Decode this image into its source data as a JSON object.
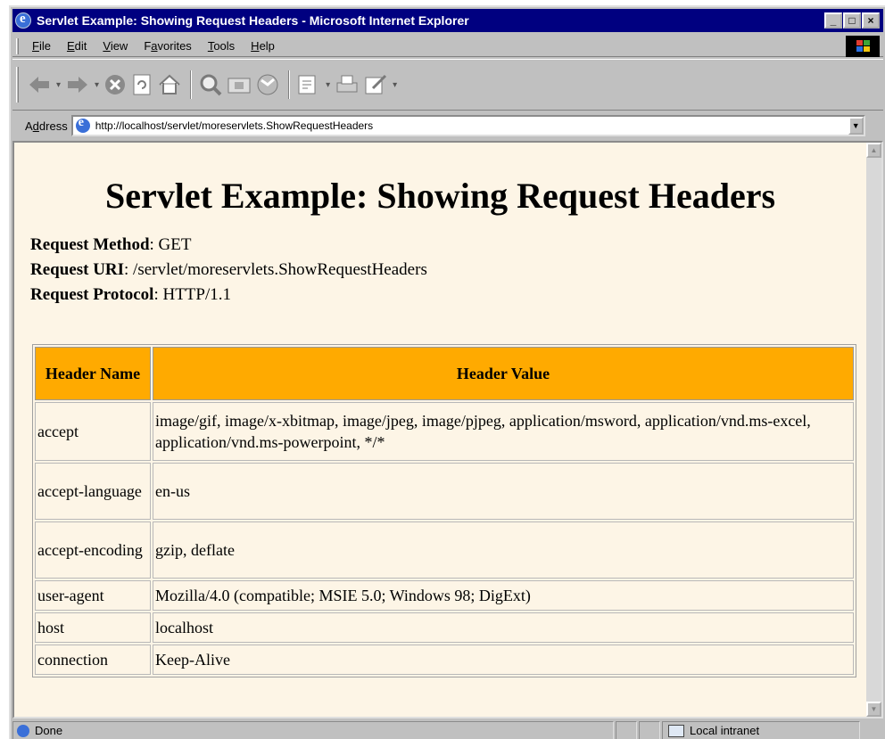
{
  "window": {
    "title": "Servlet Example: Showing Request Headers - Microsoft Internet Explorer",
    "controls": {
      "minimize": "_",
      "restore": "□",
      "close": "×"
    }
  },
  "menu": {
    "items": [
      {
        "key": "F",
        "rest": "ile"
      },
      {
        "key": "E",
        "rest": "dit"
      },
      {
        "key": "V",
        "rest": "iew"
      },
      {
        "pre": "F",
        "key": "a",
        "rest": "vorites"
      },
      {
        "key": "T",
        "rest": "ools"
      },
      {
        "key": "H",
        "rest": "elp"
      }
    ]
  },
  "toolbar": {
    "icons": [
      "back-icon",
      "forward-icon",
      "stop-icon",
      "refresh-icon",
      "home-icon",
      "search-icon",
      "favorites-icon",
      "history-icon",
      "mail-icon",
      "print-icon",
      "edit-icon"
    ]
  },
  "address": {
    "label_pre": "A",
    "label_key": "d",
    "label_rest": "dress",
    "url": "http://localhost/servlet/moreservlets.ShowRequestHeaders"
  },
  "page": {
    "title": "Servlet Example: Showing Request Headers",
    "info": [
      {
        "label": "Request Method",
        "value": ": GET"
      },
      {
        "label": "Request URI",
        "value": ": /servlet/moreservlets.ShowRequestHeaders"
      },
      {
        "label": "Request Protocol",
        "value": ": HTTP/1.1"
      }
    ],
    "table": {
      "headers": [
        "Header Name",
        "Header Value"
      ],
      "rows": [
        {
          "name": "accept",
          "value": "image/gif, image/x-xbitmap, image/jpeg, image/pjpeg, application/msword, application/vnd.ms-excel, application/vnd.ms-powerpoint, */*"
        },
        {
          "name": "accept-language",
          "value": "en-us"
        },
        {
          "name": "accept-encoding",
          "value": "gzip, deflate"
        },
        {
          "name": "user-agent",
          "value": "Mozilla/4.0 (compatible; MSIE 5.0; Windows 98; DigExt)"
        },
        {
          "name": "host",
          "value": "localhost"
        },
        {
          "name": "connection",
          "value": "Keep-Alive"
        }
      ]
    }
  },
  "status": {
    "text": "Done",
    "zone": "Local intranet"
  },
  "colors": {
    "titlebar": "#000080",
    "page_background": "#fdf5e6",
    "table_header": "#ffaa00"
  }
}
